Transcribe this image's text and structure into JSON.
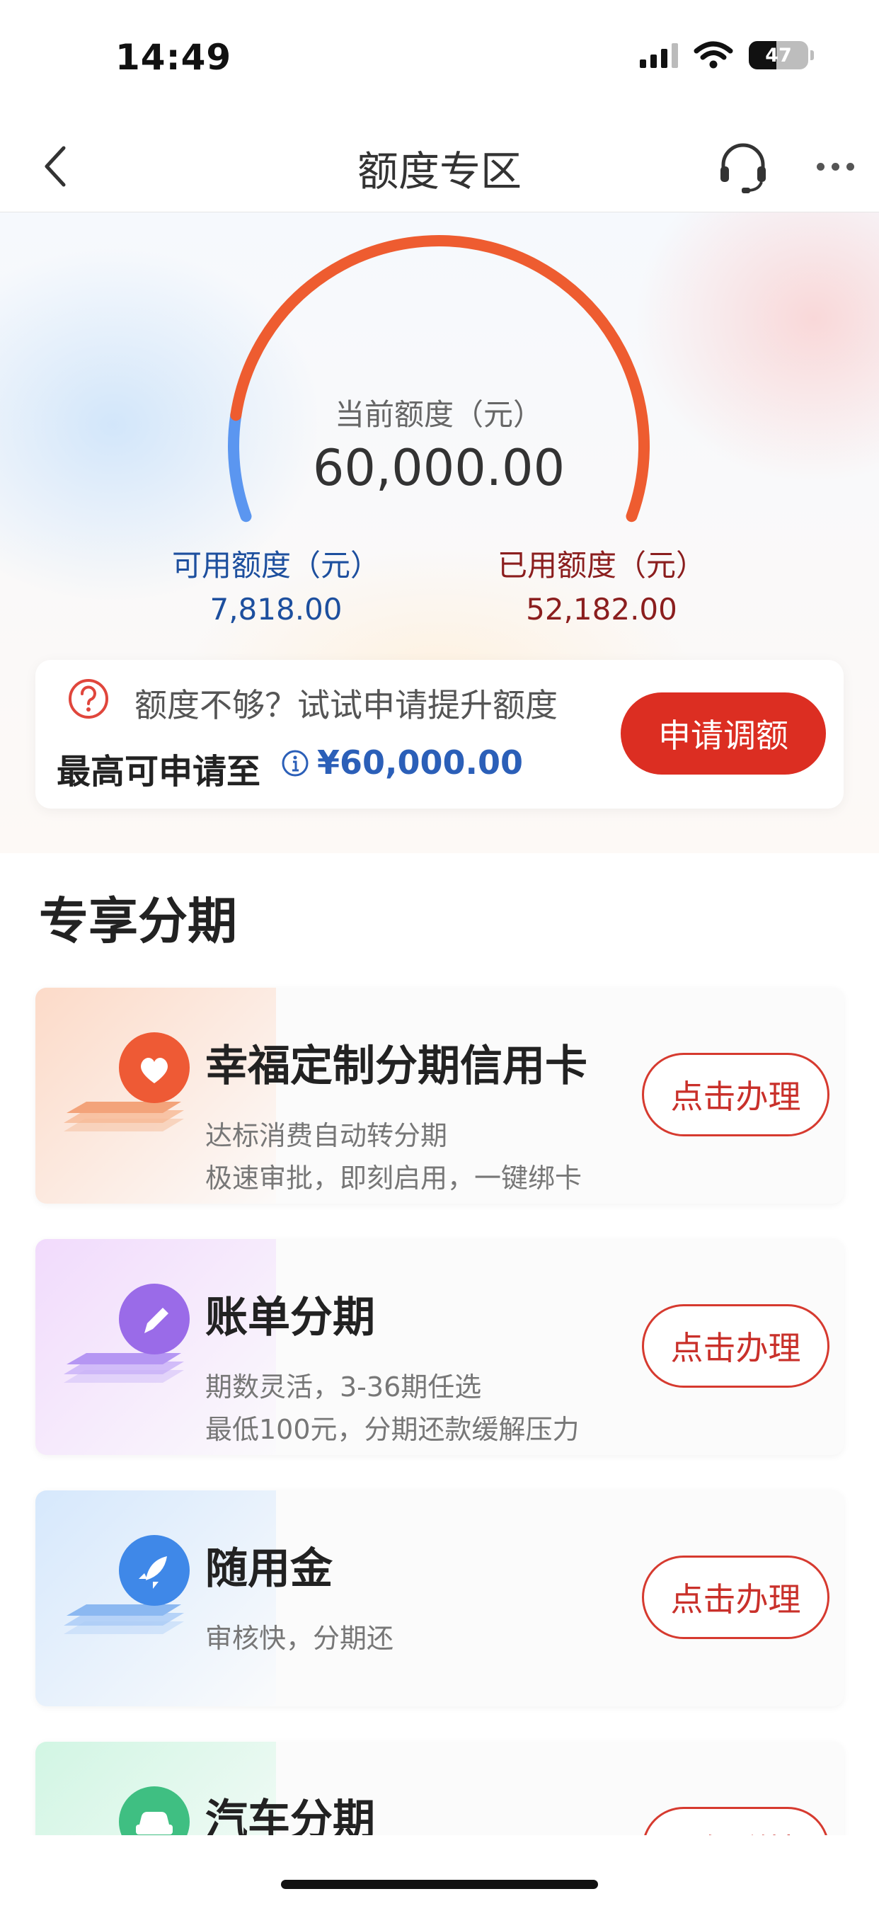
{
  "status_bar": {
    "time": "14:49",
    "battery": "47"
  },
  "nav": {
    "title": "额度专区"
  },
  "credit": {
    "current_label": "当前额度（元）",
    "current_value": "60,000.00",
    "available_label": "可用额度（元）",
    "available_value": "7,818.00",
    "used_label": "已用额度（元）",
    "used_value": "52,182.00",
    "used_fraction": 0.8697,
    "colors": {
      "used_arc": "#ee5c30",
      "available_arc": "#5b96f0"
    }
  },
  "raise": {
    "hint": "额度不够？试试申请提升额度",
    "max_label": "最高可申请至",
    "max_value": "¥60,000.00",
    "button": "申请调额"
  },
  "section": {
    "title": "专享分期"
  },
  "items": [
    {
      "title": "幸福定制分期信用卡",
      "desc1": "达标消费自动转分期",
      "desc2": "极速审批，即刻启用，一键绑卡",
      "button": "点击办理",
      "icon": "heart-icon",
      "color": "#ee5a35"
    },
    {
      "title": "账单分期",
      "desc1": "期数灵活，3-36期任选",
      "desc2": "最低100元，分期还款缓解压力",
      "button": "点击办理",
      "icon": "pencil-icon",
      "color": "#9a6be8"
    },
    {
      "title": "随用金",
      "desc1": "审核快，分期还",
      "desc2": "",
      "button": "点击办理",
      "icon": "rocket-icon",
      "color": "#3f88e8"
    },
    {
      "title": "汽车分期",
      "desc1": "",
      "desc2": "",
      "button": "了解详情",
      "icon": "car-icon",
      "color": "#3fbf82"
    }
  ]
}
